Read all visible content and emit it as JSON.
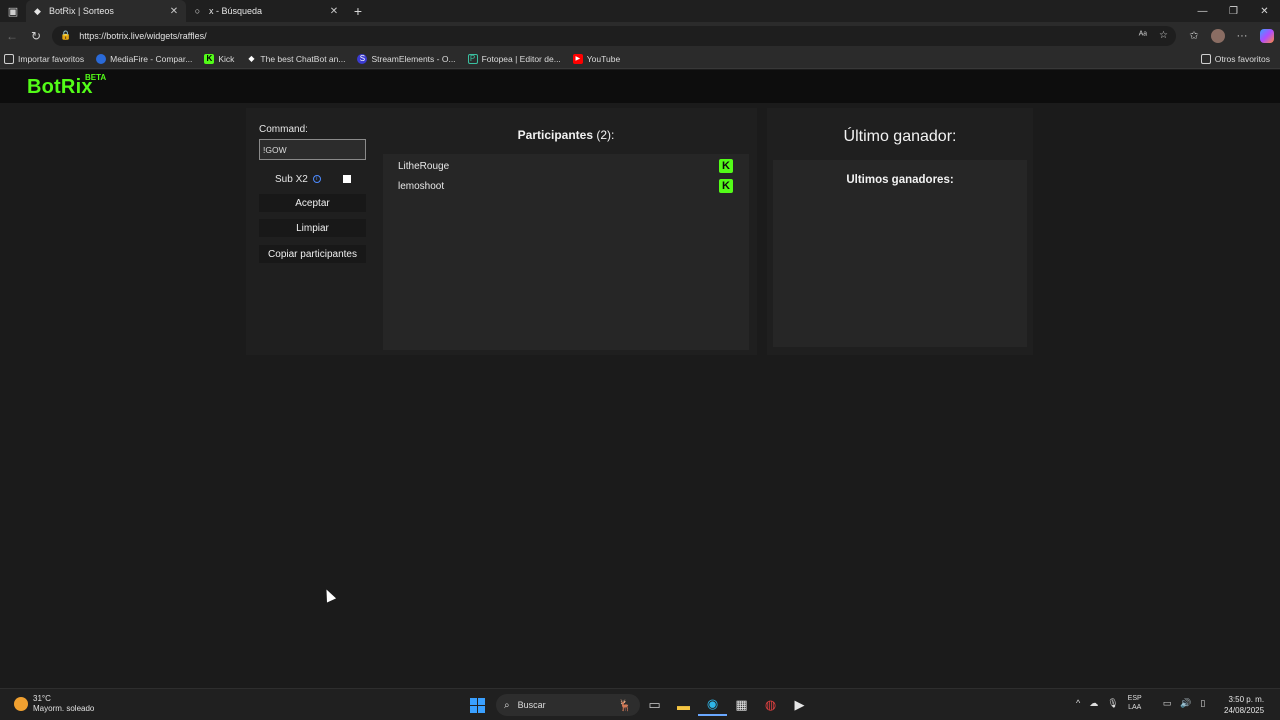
{
  "browser": {
    "tabs": [
      {
        "label": "BotRix | Sorteos",
        "active": true
      },
      {
        "label": "x - Búsqueda",
        "active": false
      }
    ],
    "url": "https://botrix.live/widgets/raffles/",
    "bookmarks": [
      {
        "label": "Importar favoritos",
        "icon": "folder-icon"
      },
      {
        "label": "MediaFire - Compar...",
        "icon": "mediafire-icon"
      },
      {
        "label": "Kick",
        "icon": "kick-icon"
      },
      {
        "label": "The best ChatBot an...",
        "icon": "botrix-icon"
      },
      {
        "label": "StreamElements - O...",
        "icon": "streamelements-icon"
      },
      {
        "label": "Fotopea | Editor de...",
        "icon": "photopea-icon"
      },
      {
        "label": "YouTube",
        "icon": "youtube-icon"
      }
    ],
    "other_bookmarks": "Otros favoritos"
  },
  "app": {
    "logo": "BotRix",
    "logo_badge": "BETA",
    "command_label": "Command:",
    "command_value": "!GOW",
    "sub_label": "Sub X2",
    "sub_checked": false,
    "buttons": {
      "accept": "Aceptar",
      "clear": "Limpiar",
      "copy": "Copiar participantes"
    },
    "participants_title": "Participantes",
    "participants_count": "(2):",
    "participants": [
      {
        "name": "LitheRouge",
        "platform": "kick-icon"
      },
      {
        "name": "lemoshoot",
        "platform": "kick-icon"
      }
    ],
    "last_winner_title": "Último ganador:",
    "winners_title": "Ultimos ganadores:",
    "accent_color": "#53fc18"
  },
  "taskbar": {
    "weather_temp": "31°C",
    "weather_desc": "Mayorm. soleado",
    "search_label": "Buscar",
    "lang_line1": "ESP",
    "lang_line2": "LAA",
    "time": "3:50 p. m.",
    "date": "24/08/2025"
  }
}
